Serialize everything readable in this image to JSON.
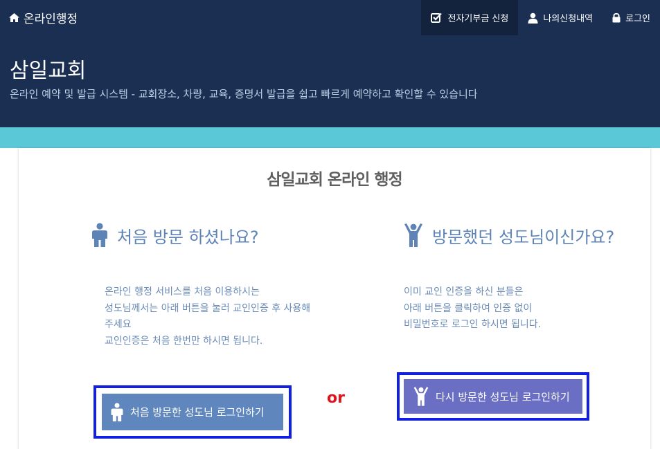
{
  "nav": {
    "brand": "온라인행정",
    "brand_icon": "home-icon",
    "items": [
      {
        "label": "전자기부금 신청",
        "icon": "checkbox-icon",
        "active": true
      },
      {
        "label": "나의신청내역",
        "icon": "user-icon",
        "active": false
      },
      {
        "label": "로그인",
        "icon": "lock-icon",
        "active": false
      }
    ]
  },
  "hero": {
    "title": "삼일교회",
    "subtitle": "온라인 예약 및 발급 시스템 - 교회장소, 차량, 교육, 증명서 발급을 쉽고 빠르게 예약하고 확인할 수 있습니다"
  },
  "main": {
    "title": "삼일교회 온라인 행정",
    "first_visit": {
      "heading": "처음 방문 하셨나요?",
      "icon": "person-standing-icon",
      "lines": [
        "온라인 행정 서비스를 처음 이용하시는",
        "성도님께서는 아래 버튼을 눌러 교인인증 후 사용해",
        "주세요",
        "교인인증은 처음 한번만 하시면 됩니다."
      ],
      "button_label": "처음 방문한 성도님 로그인하기"
    },
    "or_label": "or",
    "return_visit": {
      "heading": "방문했던 성도님이신가요?",
      "icon": "person-arms-up-icon",
      "lines": [
        "이미 교인 인증을 하신 분들은",
        "아래 버튼을 클릭하여 인증 없이",
        "비밀번호로 로그인 하시면 됩니다."
      ],
      "button_label": "다시 방문한 성도님 로그인하기"
    }
  },
  "colors": {
    "navbar": "#1a2f52",
    "active_nav": "#13233e",
    "strip": "#5bc8d8",
    "heading": "#5e84b7",
    "first_button": "#5f87bd",
    "return_button": "#6a6fc3",
    "highlight_frame": "#1120e0",
    "or": "#e0141c"
  }
}
